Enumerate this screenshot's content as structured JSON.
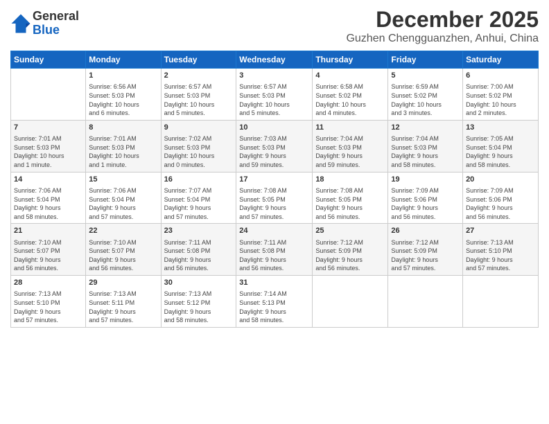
{
  "header": {
    "logo_line1": "General",
    "logo_line2": "Blue",
    "month_title": "December 2025",
    "location": "Guzhen Chengguanzhen, Anhui, China"
  },
  "weekdays": [
    "Sunday",
    "Monday",
    "Tuesday",
    "Wednesday",
    "Thursday",
    "Friday",
    "Saturday"
  ],
  "weeks": [
    [
      {
        "day": "",
        "info": ""
      },
      {
        "day": "1",
        "info": "Sunrise: 6:56 AM\nSunset: 5:03 PM\nDaylight: 10 hours\nand 6 minutes."
      },
      {
        "day": "2",
        "info": "Sunrise: 6:57 AM\nSunset: 5:03 PM\nDaylight: 10 hours\nand 5 minutes."
      },
      {
        "day": "3",
        "info": "Sunrise: 6:57 AM\nSunset: 5:03 PM\nDaylight: 10 hours\nand 5 minutes."
      },
      {
        "day": "4",
        "info": "Sunrise: 6:58 AM\nSunset: 5:02 PM\nDaylight: 10 hours\nand 4 minutes."
      },
      {
        "day": "5",
        "info": "Sunrise: 6:59 AM\nSunset: 5:02 PM\nDaylight: 10 hours\nand 3 minutes."
      },
      {
        "day": "6",
        "info": "Sunrise: 7:00 AM\nSunset: 5:02 PM\nDaylight: 10 hours\nand 2 minutes."
      }
    ],
    [
      {
        "day": "7",
        "info": "Sunrise: 7:01 AM\nSunset: 5:03 PM\nDaylight: 10 hours\nand 1 minute."
      },
      {
        "day": "8",
        "info": "Sunrise: 7:01 AM\nSunset: 5:03 PM\nDaylight: 10 hours\nand 1 minute."
      },
      {
        "day": "9",
        "info": "Sunrise: 7:02 AM\nSunset: 5:03 PM\nDaylight: 10 hours\nand 0 minutes."
      },
      {
        "day": "10",
        "info": "Sunrise: 7:03 AM\nSunset: 5:03 PM\nDaylight: 9 hours\nand 59 minutes."
      },
      {
        "day": "11",
        "info": "Sunrise: 7:04 AM\nSunset: 5:03 PM\nDaylight: 9 hours\nand 59 minutes."
      },
      {
        "day": "12",
        "info": "Sunrise: 7:04 AM\nSunset: 5:03 PM\nDaylight: 9 hours\nand 58 minutes."
      },
      {
        "day": "13",
        "info": "Sunrise: 7:05 AM\nSunset: 5:04 PM\nDaylight: 9 hours\nand 58 minutes."
      }
    ],
    [
      {
        "day": "14",
        "info": "Sunrise: 7:06 AM\nSunset: 5:04 PM\nDaylight: 9 hours\nand 58 minutes."
      },
      {
        "day": "15",
        "info": "Sunrise: 7:06 AM\nSunset: 5:04 PM\nDaylight: 9 hours\nand 57 minutes."
      },
      {
        "day": "16",
        "info": "Sunrise: 7:07 AM\nSunset: 5:04 PM\nDaylight: 9 hours\nand 57 minutes."
      },
      {
        "day": "17",
        "info": "Sunrise: 7:08 AM\nSunset: 5:05 PM\nDaylight: 9 hours\nand 57 minutes."
      },
      {
        "day": "18",
        "info": "Sunrise: 7:08 AM\nSunset: 5:05 PM\nDaylight: 9 hours\nand 56 minutes."
      },
      {
        "day": "19",
        "info": "Sunrise: 7:09 AM\nSunset: 5:06 PM\nDaylight: 9 hours\nand 56 minutes."
      },
      {
        "day": "20",
        "info": "Sunrise: 7:09 AM\nSunset: 5:06 PM\nDaylight: 9 hours\nand 56 minutes."
      }
    ],
    [
      {
        "day": "21",
        "info": "Sunrise: 7:10 AM\nSunset: 5:07 PM\nDaylight: 9 hours\nand 56 minutes."
      },
      {
        "day": "22",
        "info": "Sunrise: 7:10 AM\nSunset: 5:07 PM\nDaylight: 9 hours\nand 56 minutes."
      },
      {
        "day": "23",
        "info": "Sunrise: 7:11 AM\nSunset: 5:08 PM\nDaylight: 9 hours\nand 56 minutes."
      },
      {
        "day": "24",
        "info": "Sunrise: 7:11 AM\nSunset: 5:08 PM\nDaylight: 9 hours\nand 56 minutes."
      },
      {
        "day": "25",
        "info": "Sunrise: 7:12 AM\nSunset: 5:09 PM\nDaylight: 9 hours\nand 56 minutes."
      },
      {
        "day": "26",
        "info": "Sunrise: 7:12 AM\nSunset: 5:09 PM\nDaylight: 9 hours\nand 57 minutes."
      },
      {
        "day": "27",
        "info": "Sunrise: 7:13 AM\nSunset: 5:10 PM\nDaylight: 9 hours\nand 57 minutes."
      }
    ],
    [
      {
        "day": "28",
        "info": "Sunrise: 7:13 AM\nSunset: 5:10 PM\nDaylight: 9 hours\nand 57 minutes."
      },
      {
        "day": "29",
        "info": "Sunrise: 7:13 AM\nSunset: 5:11 PM\nDaylight: 9 hours\nand 57 minutes."
      },
      {
        "day": "30",
        "info": "Sunrise: 7:13 AM\nSunset: 5:12 PM\nDaylight: 9 hours\nand 58 minutes."
      },
      {
        "day": "31",
        "info": "Sunrise: 7:14 AM\nSunset: 5:13 PM\nDaylight: 9 hours\nand 58 minutes."
      },
      {
        "day": "",
        "info": ""
      },
      {
        "day": "",
        "info": ""
      },
      {
        "day": "",
        "info": ""
      }
    ]
  ]
}
